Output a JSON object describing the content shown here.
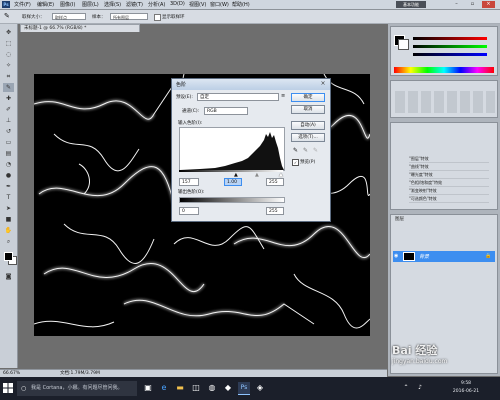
{
  "menubar": {
    "items": [
      "文件(F)",
      "编辑(E)",
      "图像(I)",
      "图层(L)",
      "选择(S)",
      "滤镜(T)",
      "分析(A)",
      "3D(D)",
      "视图(V)",
      "窗口(W)",
      "帮助(H)"
    ],
    "workspace": "基本功能"
  },
  "options": {
    "sample_size_label": "取样大小：",
    "sample_size_value": "取样点",
    "sample_label": "样本：",
    "sample_value": "所有图层",
    "show_ring_label": "显示取样环"
  },
  "document": {
    "tab_title": "未标题-1 @ 66.7% (RGB/8) *",
    "zoom": "66.67%",
    "doc_size": "文档:1.79M/3.79M"
  },
  "panels": {
    "history_items": [
      "\"图层\"特效",
      "\"曲线\"特效",
      "\"曝光度\"特效",
      "\"色相/饱和度\"特效",
      "\"渐变映射\"特效",
      "\"可选颜色\"特效"
    ],
    "layers_tab": "图层",
    "layer_name": "背景"
  },
  "dialog": {
    "title": "色阶",
    "preset_label": "预设(E):",
    "preset_value": "自定",
    "channel_label": "通道(C):",
    "channel_value": "RGB",
    "input_levels_label": "输入色阶(I):",
    "input_black": "157",
    "input_gamma": "1.00",
    "input_white": "255",
    "output_levels_label": "输出色阶(O):",
    "output_black": "0",
    "output_white": "255",
    "ok_label": "确定",
    "cancel_label": "取消",
    "auto_label": "自动(A)",
    "options_label": "选项(T)...",
    "preview_label": "预览(P)"
  },
  "taskbar": {
    "search_placeholder": "我是 Cortana，小娜。有问题尽管问我。",
    "time": "9:58",
    "date": "2016-06-21"
  },
  "watermark": {
    "brand": "Bai 经验",
    "url": "jingyan.baidu.com"
  },
  "colors": {
    "accent": "#3d8ef0",
    "dialog_title": "#bccfe5",
    "taskbar": "#1b1f2a"
  }
}
